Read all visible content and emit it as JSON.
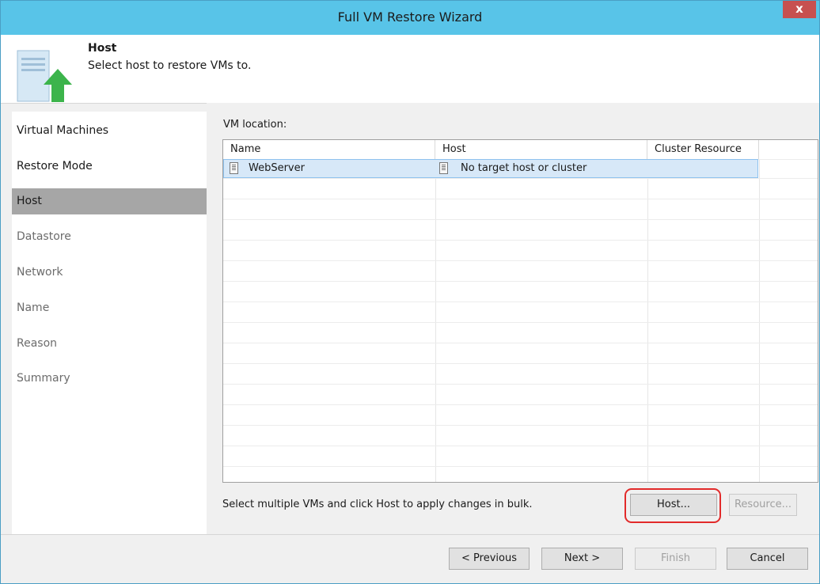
{
  "window": {
    "title": "Full VM Restore Wizard",
    "close_label": "x"
  },
  "header": {
    "title": "Host",
    "description": "Select host to restore VMs to."
  },
  "steps": [
    {
      "label": "Virtual Machines",
      "state": "done"
    },
    {
      "label": "Restore Mode",
      "state": "done"
    },
    {
      "label": "Host",
      "state": "active"
    },
    {
      "label": "Datastore",
      "state": "future"
    },
    {
      "label": "Network",
      "state": "future"
    },
    {
      "label": "Name",
      "state": "future"
    },
    {
      "label": "Reason",
      "state": "future"
    },
    {
      "label": "Summary",
      "state": "future"
    }
  ],
  "main": {
    "location_label": "VM location:",
    "columns": [
      "Name",
      "Host",
      "Cluster Resource"
    ],
    "rows": [
      {
        "name": "WebServer",
        "host": "No target host or cluster",
        "cluster_resource": ""
      }
    ],
    "hint": "Select multiple VMs and click Host to apply changes in bulk.",
    "host_button": "Host...",
    "resource_button": "Resource..."
  },
  "footer": {
    "previous": "< Previous",
    "next": "Next >",
    "finish": "Finish",
    "cancel": "Cancel"
  },
  "colors": {
    "titlebar": "#58c4e8",
    "active_step": "#a6a6a6",
    "selected_row": "#d7e8f8",
    "highlight": "#e22a2a",
    "arrow_green": "#3cb44b"
  }
}
